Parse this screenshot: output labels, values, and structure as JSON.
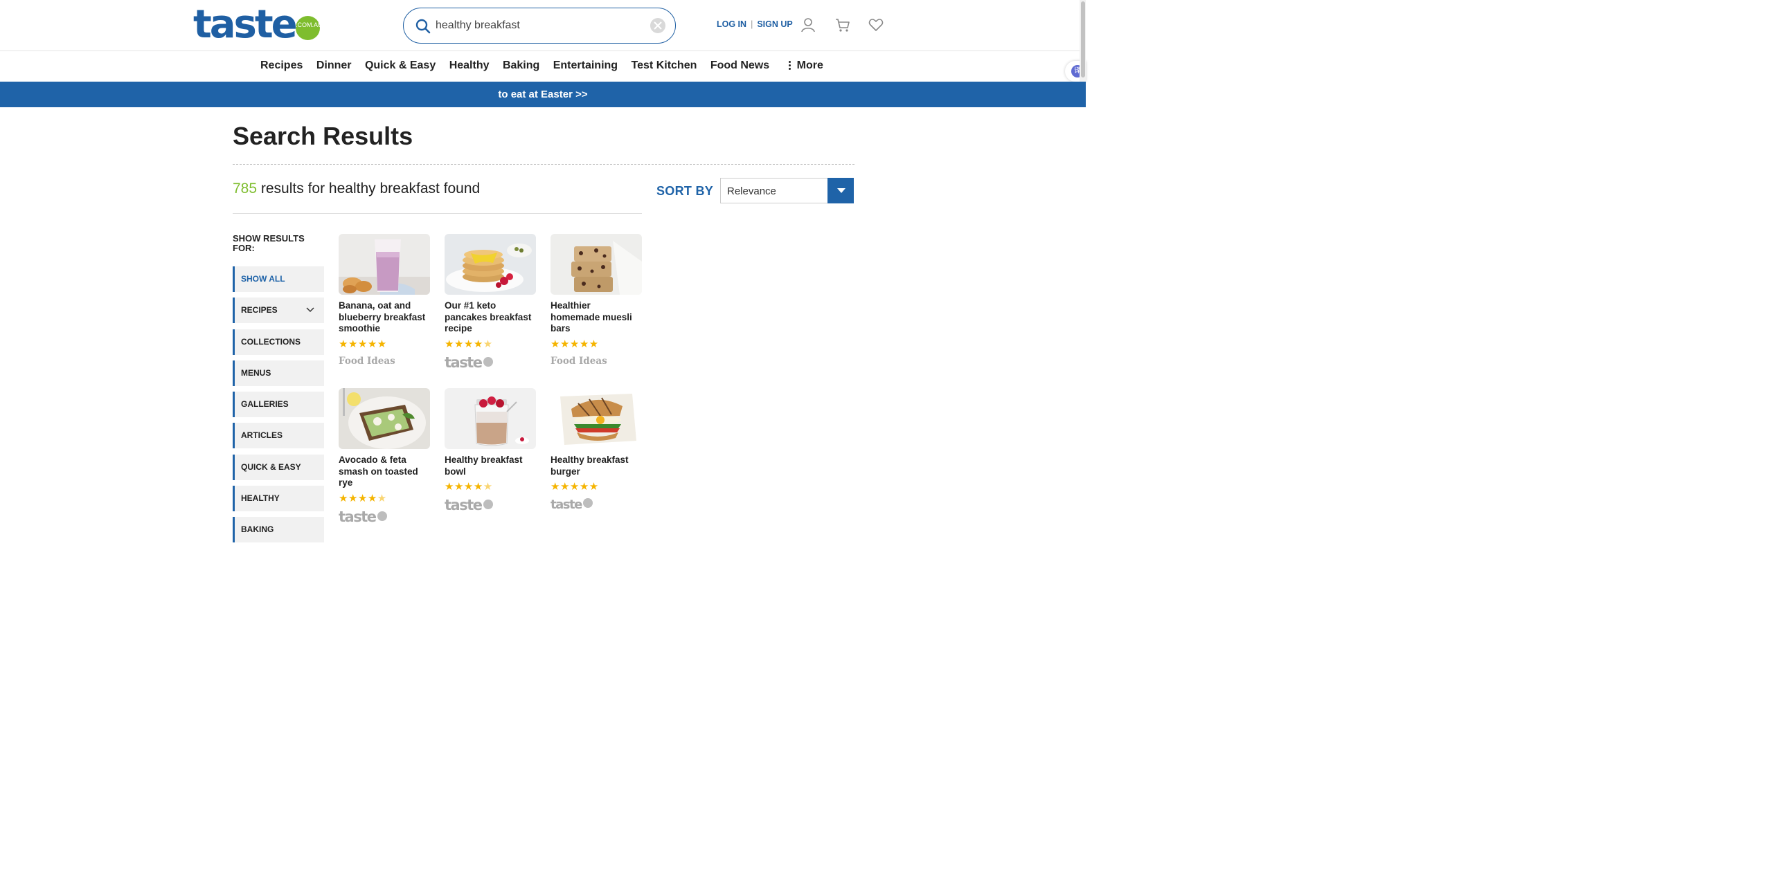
{
  "header": {
    "logo_text": "taste",
    "logo_badge": ".COM.AU",
    "search_value": "healthy breakfast",
    "login": "LOG IN",
    "separator": "|",
    "signup": "SIGN UP",
    "icons": [
      "search-icon",
      "clear-icon",
      "user-icon",
      "cart-icon",
      "heart-icon"
    ]
  },
  "nav": {
    "items": [
      "Recipes",
      "Dinner",
      "Quick & Easy",
      "Healthy",
      "Baking",
      "Entertaining",
      "Test Kitchen",
      "Food News"
    ],
    "more": "More"
  },
  "side_tab": "译",
  "banner": "to eat at Easter >>",
  "main": {
    "title": "Search Results",
    "results_count": "785",
    "results_text": " results for healthy breakfast found",
    "sort_label": "SORT BY",
    "sort_value": "Relevance"
  },
  "filters": {
    "heading": "SHOW RESULTS FOR:",
    "items": [
      "SHOW ALL",
      "RECIPES",
      "COLLECTIONS",
      "MENUS",
      "GALLERIES",
      "ARTICLES",
      "QUICK & EASY",
      "HEALTHY",
      "BAKING"
    ]
  },
  "cards": [
    {
      "title": "Banana, oat and blueberry breakfast smoothie",
      "rating": 5,
      "brand": "Food Ideas"
    },
    {
      "title": "Our #1 keto pancakes breakfast recipe",
      "rating": 4.5,
      "brand": "taste"
    },
    {
      "title": "Healthier homemade muesli bars",
      "rating": 5,
      "brand": "Food Ideas"
    },
    {
      "title": "Avocado & feta smash on toasted rye",
      "rating": 4.5,
      "brand": "taste"
    },
    {
      "title": "Healthy breakfast bowl",
      "rating": 4.5,
      "brand": "taste"
    },
    {
      "title": "Healthy breakfast burger",
      "rating": 5,
      "brand": "taste"
    }
  ],
  "colors": {
    "brand_blue": "#1f5fa3",
    "banner_blue": "#1f63a8",
    "accent_green": "#7ebd2e",
    "star": "#f5b400"
  }
}
